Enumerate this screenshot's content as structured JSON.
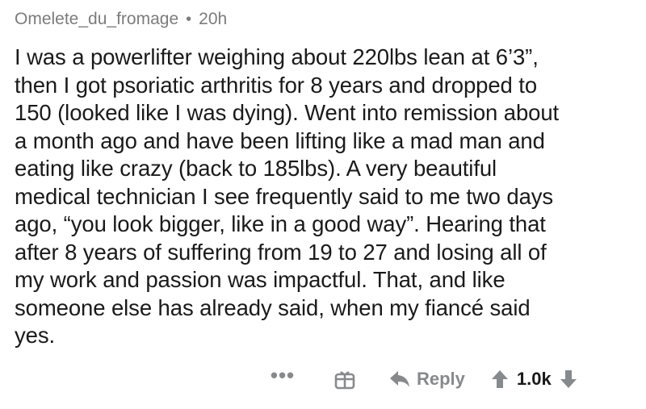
{
  "comment": {
    "author": "Omelete_du_fromage",
    "separator": "•",
    "age": "20h",
    "lines": [
      "I was a powerlifter weighing about 220lbs lean at 6’3”,",
      "then I got psoriatic arthritis for 8 years and dropped to",
      "150 (looked like I was dying). Went into remission about",
      "a month ago and have been lifting like a mad man and",
      "eating like crazy (back to 185lbs). A very beautiful",
      "medical technician I see frequently said to me two days",
      "ago, “you look bigger, like in a good way”. Hearing that",
      "after 8 years of suffering from 19 to 27 and losing all of",
      "my work and passion was impactful. That, and like",
      "someone else has already said, when my fiancé said",
      "yes."
    ]
  },
  "actions": {
    "more_label": "•••",
    "reply_label": "Reply",
    "score": "1.0k",
    "icons": {
      "award": "gift-icon",
      "reply": "reply-arrow-icon",
      "upvote": "upvote-arrow-icon",
      "downvote": "downvote-arrow-icon"
    },
    "icon_color": "#878a8c"
  }
}
